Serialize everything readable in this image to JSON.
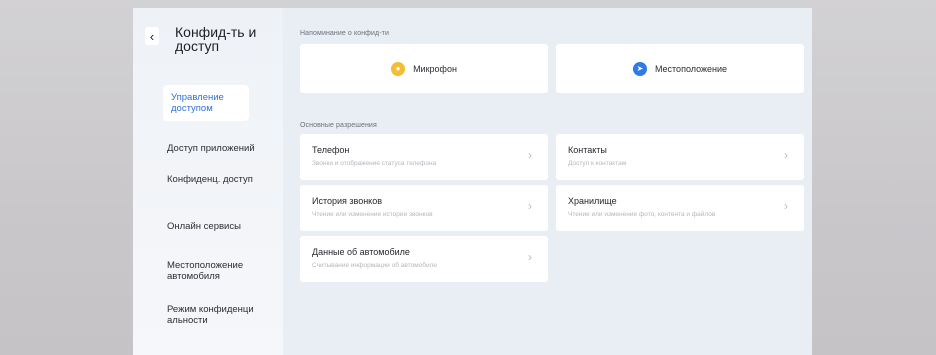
{
  "sidebar": {
    "back_icon": "chevron-left-icon",
    "title": "Конфид-ть и доступ",
    "items": [
      {
        "label": "Управление доступом",
        "active": true
      },
      {
        "label": "Доступ приложений",
        "active": false
      },
      {
        "label": "Конфиденц. доступ",
        "active": false
      },
      {
        "label": "Онлайн сервисы",
        "active": false
      },
      {
        "label": "Местоположение автомобиля",
        "active": false
      },
      {
        "label": "Режим конфиденци альности",
        "active": false
      }
    ]
  },
  "reminder": {
    "section_label": "Напоминание о конфид-ти",
    "cards": [
      {
        "label": "Микрофон",
        "icon": "microphone-icon",
        "color": "#f3be35"
      },
      {
        "label": "Местоположение",
        "icon": "location-icon",
        "color": "#2f7ae8"
      }
    ]
  },
  "permissions": {
    "section_label": "Основные разрешения",
    "cards": [
      {
        "title": "Телефон",
        "desc": "Звонки и отображение статуса телефона"
      },
      {
        "title": "Контакты",
        "desc": "Доступ к контактам"
      },
      {
        "title": "История звонков",
        "desc": "Чтение или изменение истории звонков"
      },
      {
        "title": "Хранилище",
        "desc": "Чтение или изменение фото, контента и файлов"
      },
      {
        "title": "Данные об автомобиле",
        "desc": "Считывание информации об автомобиле"
      }
    ]
  },
  "colors": {
    "accent": "#2f6fdc",
    "panel": "#e9eef5"
  }
}
